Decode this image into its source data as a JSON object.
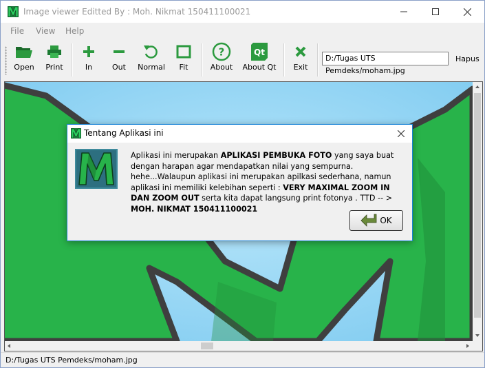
{
  "window": {
    "title": "Image viewer Editted By : Moh. Nikmat 150411100021"
  },
  "menu": [
    "File",
    "View",
    "Help"
  ],
  "toolbar": {
    "open": "Open",
    "print": "Print",
    "zoom_in": "In",
    "zoom_out": "Out",
    "normal": "Normal",
    "fit": "Fit",
    "about": "About",
    "about_qt": "About Qt",
    "exit": "Exit",
    "path_value": "D:/Tugas UTS Pemdeks/moham.jpg",
    "hapus": "Hapus"
  },
  "dialog": {
    "title": "Tentang Aplikasi ini",
    "message_parts": [
      "Aplikasi ini merupakan ",
      "APLIKASI PEMBUKA FOTO",
      " yang saya buat dengan harapan agar mendapatkan nilai yang sempurna. hehe...Walaupun aplikasi ini merupakan apilkasi sederhana, namun aplikasi ini memiliki kelebihan seperti : ",
      "VERY MAXIMAL ZOOM IN DAN ZOOM OUT",
      " serta kita dapat langsung print fotonya . TTD -- > ",
      "MOH. NIKMAT 150411100021"
    ],
    "ok": "OK"
  },
  "status": {
    "text": "D:/Tugas UTS Pemdeks/moham.jpg"
  },
  "colors": {
    "accent": "#1883d7",
    "logo_green": "#1fa84a",
    "sky": "#8fd3f0"
  }
}
